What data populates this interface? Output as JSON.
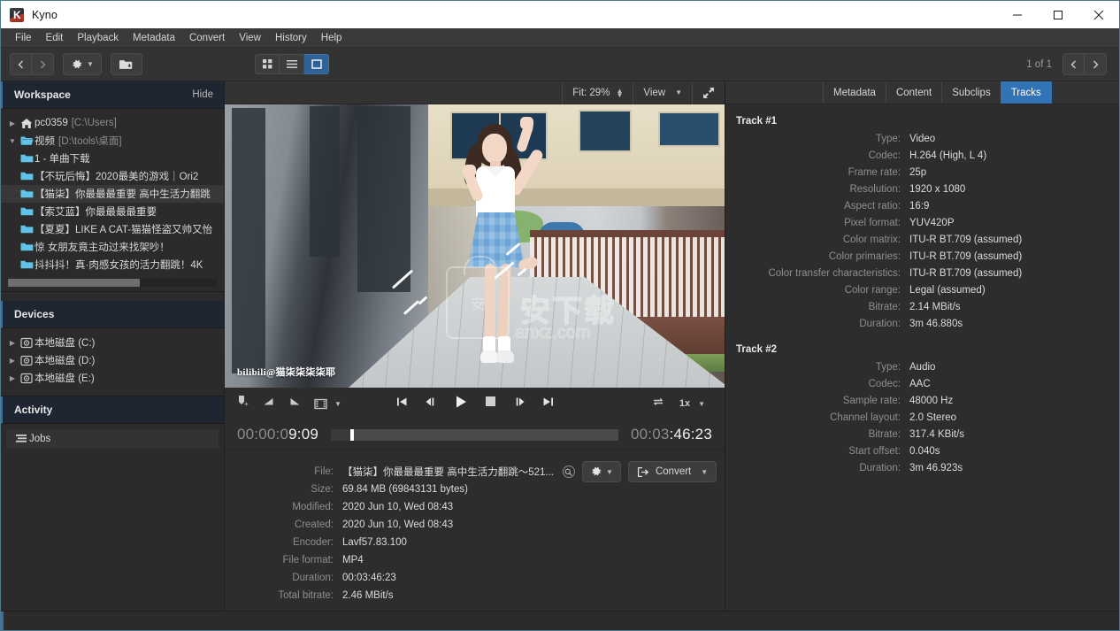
{
  "window": {
    "title": "Kyno",
    "minimize_label": "Minimize",
    "maximize_label": "Maximize",
    "close_label": "Close"
  },
  "menubar": {
    "items": [
      "File",
      "Edit",
      "Playback",
      "Metadata",
      "Convert",
      "View",
      "History",
      "Help"
    ]
  },
  "toolbar": {
    "back_label": "Back",
    "forward_label": "Forward",
    "settings_label": "Settings",
    "add_folder_label": "Add folder",
    "view_modes": [
      "grid-view",
      "list-view",
      "single-view"
    ],
    "active_view_mode": "single-view",
    "page_count": "1 of 1",
    "prev_item_label": "Previous item",
    "next_item_label": "Next item"
  },
  "sidebar": {
    "workspace": {
      "title": "Workspace",
      "action": "Hide",
      "tree": [
        {
          "label": "pc0359",
          "sub": "[C:\\Users]",
          "icon": "home-icon",
          "twisty": "collapsed",
          "depth": 0,
          "selected": false
        },
        {
          "label": "视频",
          "sub": "[D:\\tools\\桌面]",
          "icon": "folder-open-icon",
          "twisty": "expanded",
          "depth": 0,
          "selected": false
        },
        {
          "label": "1 - 单曲下载",
          "sub": "",
          "icon": "folder-icon",
          "twisty": "none",
          "depth": 1,
          "selected": false
        },
        {
          "label": "【不玩后悔】2020最美的游戏｜Ori2",
          "sub": "",
          "icon": "folder-icon",
          "twisty": "none",
          "depth": 1,
          "selected": false
        },
        {
          "label": "【猫柒】你最最最重要 高中生活力翻跳",
          "sub": "",
          "icon": "folder-icon",
          "twisty": "none",
          "depth": 1,
          "selected": true
        },
        {
          "label": "【索艾蓝】你最最最最重要",
          "sub": "",
          "icon": "folder-icon",
          "twisty": "none",
          "depth": 1,
          "selected": false
        },
        {
          "label": "【夏夏】LIKE A CAT-猫猫怪盗又帅又怡",
          "sub": "",
          "icon": "folder-icon",
          "twisty": "none",
          "depth": 1,
          "selected": false
        },
        {
          "label": "惊 女朋友竟主动过来找架吵！",
          "sub": "",
          "icon": "folder-icon",
          "twisty": "none",
          "depth": 1,
          "selected": false
        },
        {
          "label": "抖抖抖！真·肉感女孩的活力翻跳！4K",
          "sub": "",
          "icon": "folder-icon",
          "twisty": "none",
          "depth": 1,
          "selected": false
        }
      ]
    },
    "devices": {
      "title": "Devices",
      "items": [
        {
          "label": "本地磁盘 (C:)"
        },
        {
          "label": "本地磁盘 (D:)"
        },
        {
          "label": "本地磁盘 (E:)"
        }
      ]
    },
    "activity": {
      "title": "Activity",
      "items": [
        {
          "label": "Jobs",
          "icon": "jobs-icon"
        }
      ]
    }
  },
  "viewer": {
    "fit_label": "Fit: 29%",
    "view_label": "View",
    "fullscreen_label": "Fullscreen",
    "caption": "bilibili@猫柒柒柒柒耶",
    "watermark_text": "安下载",
    "watermark_sub": "anxz.com",
    "watermark_mark": "安"
  },
  "transport": {
    "marker_label": "Add marker",
    "mark_in_label": "Mark in",
    "mark_out_label": "Mark out",
    "filmstrip_label": "Filmstrip options",
    "go_start_label": "Go to start",
    "step_back_label": "Step back",
    "play_label": "Play",
    "stop_label": "Stop",
    "step_forward_label": "Step forward",
    "go_end_label": "Go to end",
    "loop_label": "Loop",
    "speed_label": "1x",
    "current_timecode_dim": "00:00:0",
    "current_timecode_bright": "9:09",
    "total_timecode_dim": "00:03",
    "total_timecode_bright": ":46:23"
  },
  "file_info": {
    "rows": [
      {
        "label": "File:",
        "value": "【猫柒】你最最最重要 高中生活力翻跳～521..."
      },
      {
        "label": "Size:",
        "value": "69.84 MB (69843131 bytes)"
      },
      {
        "label": "Modified:",
        "value": "2020 Jun 10, Wed 08:43"
      },
      {
        "label": "Created:",
        "value": "2020 Jun 10, Wed 08:43"
      },
      {
        "label": "Encoder:",
        "value": "Lavf57.83.100"
      },
      {
        "label": "File format:",
        "value": "MP4"
      },
      {
        "label": "Duration:",
        "value": "00:03:46:23"
      },
      {
        "label": "Total bitrate:",
        "value": "2.46 MBit/s"
      }
    ],
    "reveal_label": "Reveal",
    "settings_label": "File settings",
    "convert_label": "Convert"
  },
  "right_panel": {
    "tabs": [
      {
        "label": "Metadata",
        "active": false
      },
      {
        "label": "Content",
        "active": false
      },
      {
        "label": "Subclips",
        "active": false
      },
      {
        "label": "Tracks",
        "active": true
      }
    ],
    "tracks": [
      {
        "title": "Track #1",
        "rows": [
          {
            "label": "Type:",
            "value": "Video"
          },
          {
            "label": "Codec:",
            "value": "H.264 (High, L 4)"
          },
          {
            "label": "Frame rate:",
            "value": "25p"
          },
          {
            "label": "Resolution:",
            "value": "1920 x 1080"
          },
          {
            "label": "Aspect ratio:",
            "value": "16:9"
          },
          {
            "label": "Pixel format:",
            "value": "YUV420P"
          },
          {
            "label": "Color matrix:",
            "value": "ITU-R BT.709 (assumed)"
          },
          {
            "label": "Color primaries:",
            "value": "ITU-R BT.709 (assumed)"
          },
          {
            "label": "Color transfer characteristics:",
            "value": "ITU-R BT.709 (assumed)"
          },
          {
            "label": "Color range:",
            "value": "Legal (assumed)"
          },
          {
            "label": "Bitrate:",
            "value": "2.14 MBit/s"
          },
          {
            "label": "Duration:",
            "value": "3m 46.880s"
          }
        ]
      },
      {
        "title": "Track #2",
        "rows": [
          {
            "label": "Type:",
            "value": "Audio"
          },
          {
            "label": "Codec:",
            "value": "AAC"
          },
          {
            "label": "Sample rate:",
            "value": "48000 Hz"
          },
          {
            "label": "Channel layout:",
            "value": "2.0 Stereo"
          },
          {
            "label": "Bitrate:",
            "value": "317.4 KBit/s"
          },
          {
            "label": "Start offset:",
            "value": "0.040s"
          },
          {
            "label": "Duration:",
            "value": "3m 46.923s"
          }
        ]
      }
    ]
  },
  "colors": {
    "accent": "#3273b5",
    "panel_head": "#1f2531",
    "background": "#2d2d2d",
    "folder_icon": "#5fc4e8"
  }
}
